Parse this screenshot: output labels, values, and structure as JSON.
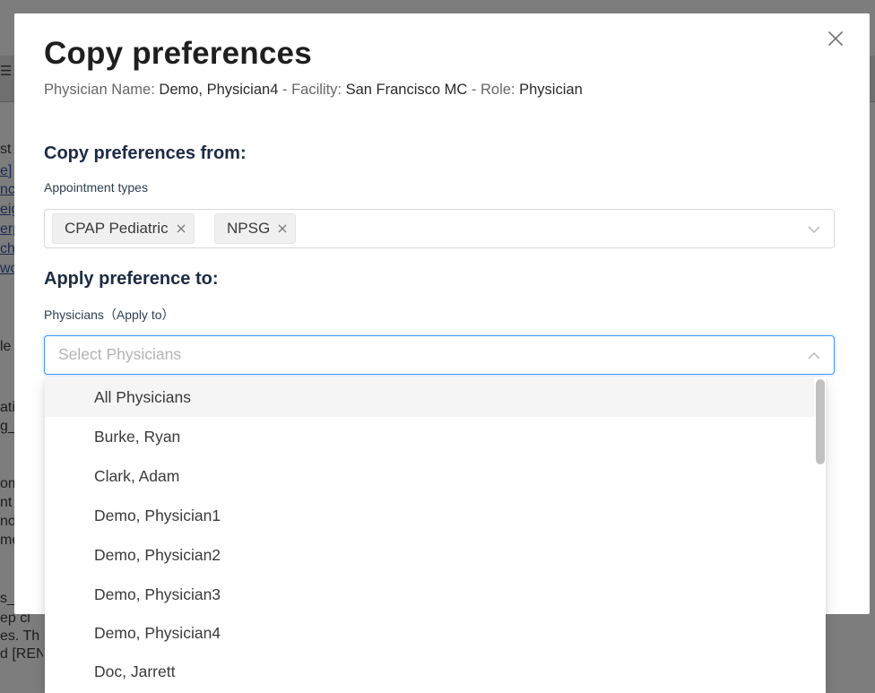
{
  "modal": {
    "title": "Copy preferences",
    "subtitle": {
      "physician_label": "Physician Name:",
      "physician_value": "Demo, Physician4",
      "sep1": "-",
      "facility_label": "Facility:",
      "facility_value": "San Francisco MC",
      "sep2": "-",
      "role_label": "Role:",
      "role_value": "Physician"
    }
  },
  "copy_from": {
    "heading": "Copy preferences from:",
    "label": "Appointment types",
    "tags": [
      "CPAP Pediatric",
      "NPSG"
    ]
  },
  "apply_to": {
    "heading": "Apply preference to:",
    "label": "Physicians（Apply to）",
    "placeholder": "Select Physicians"
  },
  "dropdown": {
    "options": [
      "All Physicians",
      "Burke, Ryan",
      "Clark, Adam",
      "Demo, Physician1",
      "Demo, Physician2",
      "Demo, Physician3",
      "Demo, Physician4",
      "Doc, Jarrett"
    ],
    "active_index": 0
  },
  "background": {
    "fragments": [
      "st",
      "e]",
      "nc",
      "eig",
      "erp",
      "chi",
      "wo",
      "le",
      "ati",
      "g_",
      "om",
      "nt",
      "no",
      "me",
      "s_c"
    ],
    "lines": [
      "ep cl",
      "es. Th",
      "d [REN"
    ]
  },
  "colors": {
    "accent": "#1677ff",
    "focus_border": "#4096ff",
    "heading": "#1d2b42"
  }
}
